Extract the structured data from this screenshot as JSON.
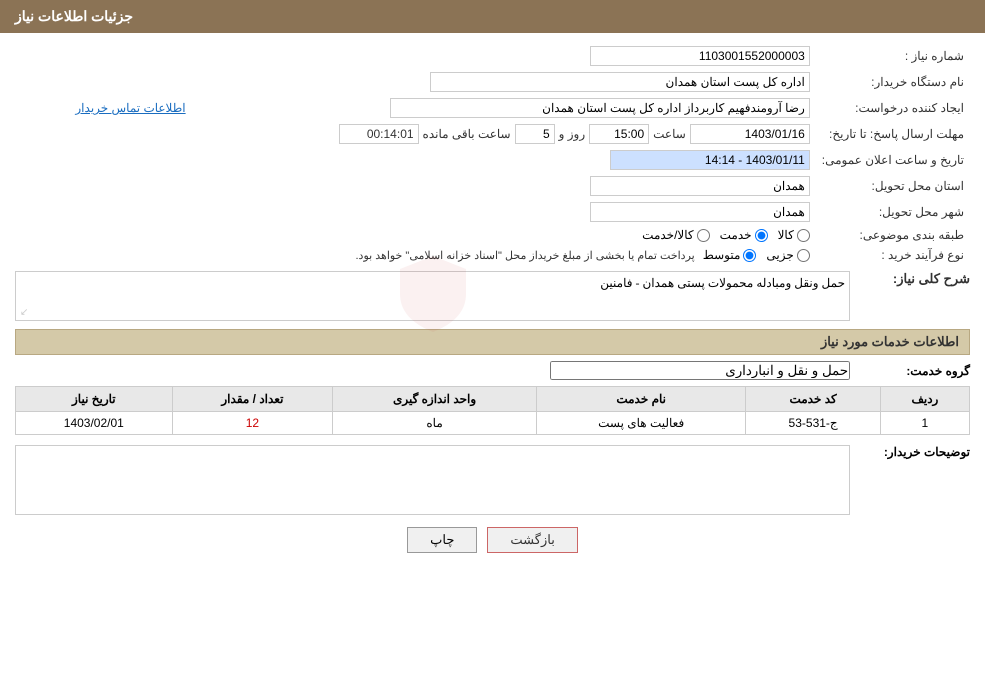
{
  "header": {
    "title": "جزئیات اطلاعات نیاز"
  },
  "fields": {
    "shomareNiaz_label": "شماره نیاز :",
    "shomareNiaz_value": "1103001552000003",
    "namDasgah_label": "نام دستگاه خریدار:",
    "namDasgah_value": "اداره کل پست استان همدان",
    "ijadKonande_label": "ایجاد کننده درخواست:",
    "ijadKonande_value": "رضا آرومندفهیم کاربرداز اداره کل پست استان همدان",
    "tamasLink": "اطلاعات تماس خریدار",
    "mohlatErsalLabel": "مهلت ارسال پاسخ: تا تاریخ:",
    "date_value": "1403/01/16",
    "saat_label": "ساعت",
    "saat_value": "15:00",
    "roz_label": "روز و",
    "roz_value": "5",
    "baghimande_label": "ساعت باقی مانده",
    "baghimande_value": "00:14:01",
    "tarikhElanLabel": "تاریخ و ساعت اعلان عمومی:",
    "tarikhElan_value": "1403/01/11 - 14:14",
    "ostanTahvilLabel": "استان محل تحویل:",
    "ostanTahvil_value": "همدان",
    "shahrTahvilLabel": "شهر محل تحویل:",
    "shahrTahvil_value": "همدان",
    "tabaqebondiLabel": "طبقه بندی موضوعی:",
    "tabaqebondi_options": [
      {
        "value": "kala",
        "label": "کالا"
      },
      {
        "value": "khadamat",
        "label": "خدمت"
      },
      {
        "value": "kala_khadamat",
        "label": "کالا/خدمت"
      }
    ],
    "tabaqebondi_selected": "khadamat",
    "noeFarayandLabel": "نوع فرآیند خرید :",
    "noeFarayand_options": [
      {
        "value": "jazei",
        "label": "جزیی"
      },
      {
        "value": "mottaset",
        "label": "متوسط"
      }
    ],
    "noeFarayand_selected": "mottaset",
    "noeFarayand_note": "پرداخت تمام یا بخشی از مبلغ خریداز محل \"اسناد خزانه اسلامی\" خواهد بود.",
    "shahreKoliLabel": "شرح کلی نیاز:",
    "shahreKoli_value": "حمل ونقل ومبادله محمولات پستی   همدان - فامنین",
    "khadamatSection": "اطلاعات خدمات مورد نیاز",
    "grohKhadamatLabel": "گروه خدمت:",
    "grohKhadamat_value": "حمل و نقل و انبارداری",
    "tableHeaders": {
      "radif": "ردیف",
      "kodKhadamat": "کد خدمت",
      "namKhadamat": "نام خدمت",
      "vahedAndaze": "واحد اندازه گیری",
      "tedad": "تعداد / مقدار",
      "tarikh": "تاریخ نیاز"
    },
    "tableRows": [
      {
        "radif": "1",
        "kodKhadamat": "ج-531-53",
        "namKhadamat": "فعالیت های پست",
        "vahedAndaze": "ماه",
        "tedad": "12",
        "tarikh": "1403/02/01"
      }
    ],
    "tozihKharidarLabel": "توضیحات خریدار:",
    "tozihKharidar_value": "",
    "buttons": {
      "print": "چاپ",
      "back": "بازگشت"
    }
  }
}
